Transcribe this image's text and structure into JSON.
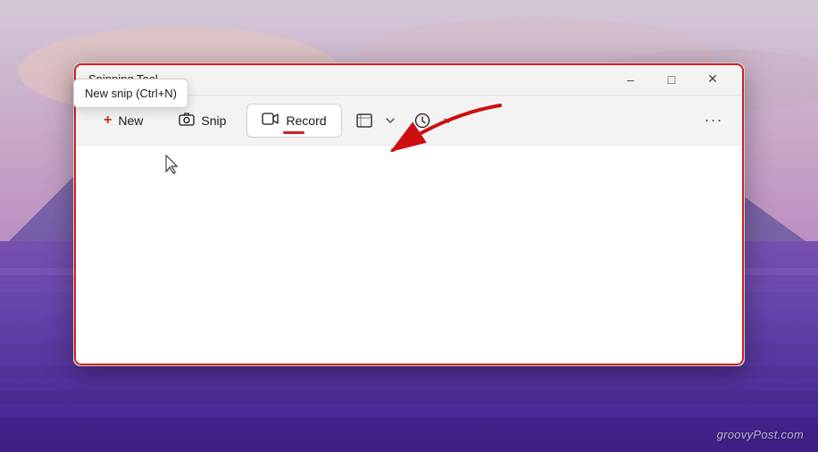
{
  "background": {
    "watermark": "groovyPost.com"
  },
  "window": {
    "title": "Snipping Tool",
    "titlebar": {
      "minimize_label": "–",
      "maximize_label": "□",
      "close_label": "✕"
    },
    "toolbar": {
      "new_label": "New",
      "snip_label": "Snip",
      "record_label": "Record",
      "new_icon": "+",
      "snip_icon": "📷",
      "record_icon": "📹"
    }
  },
  "tooltip": {
    "text": "New snip (Ctrl+N)"
  },
  "icons": {
    "screen_select": "☐",
    "chevron_down": "⌄",
    "history": "🕐",
    "more": "..."
  }
}
